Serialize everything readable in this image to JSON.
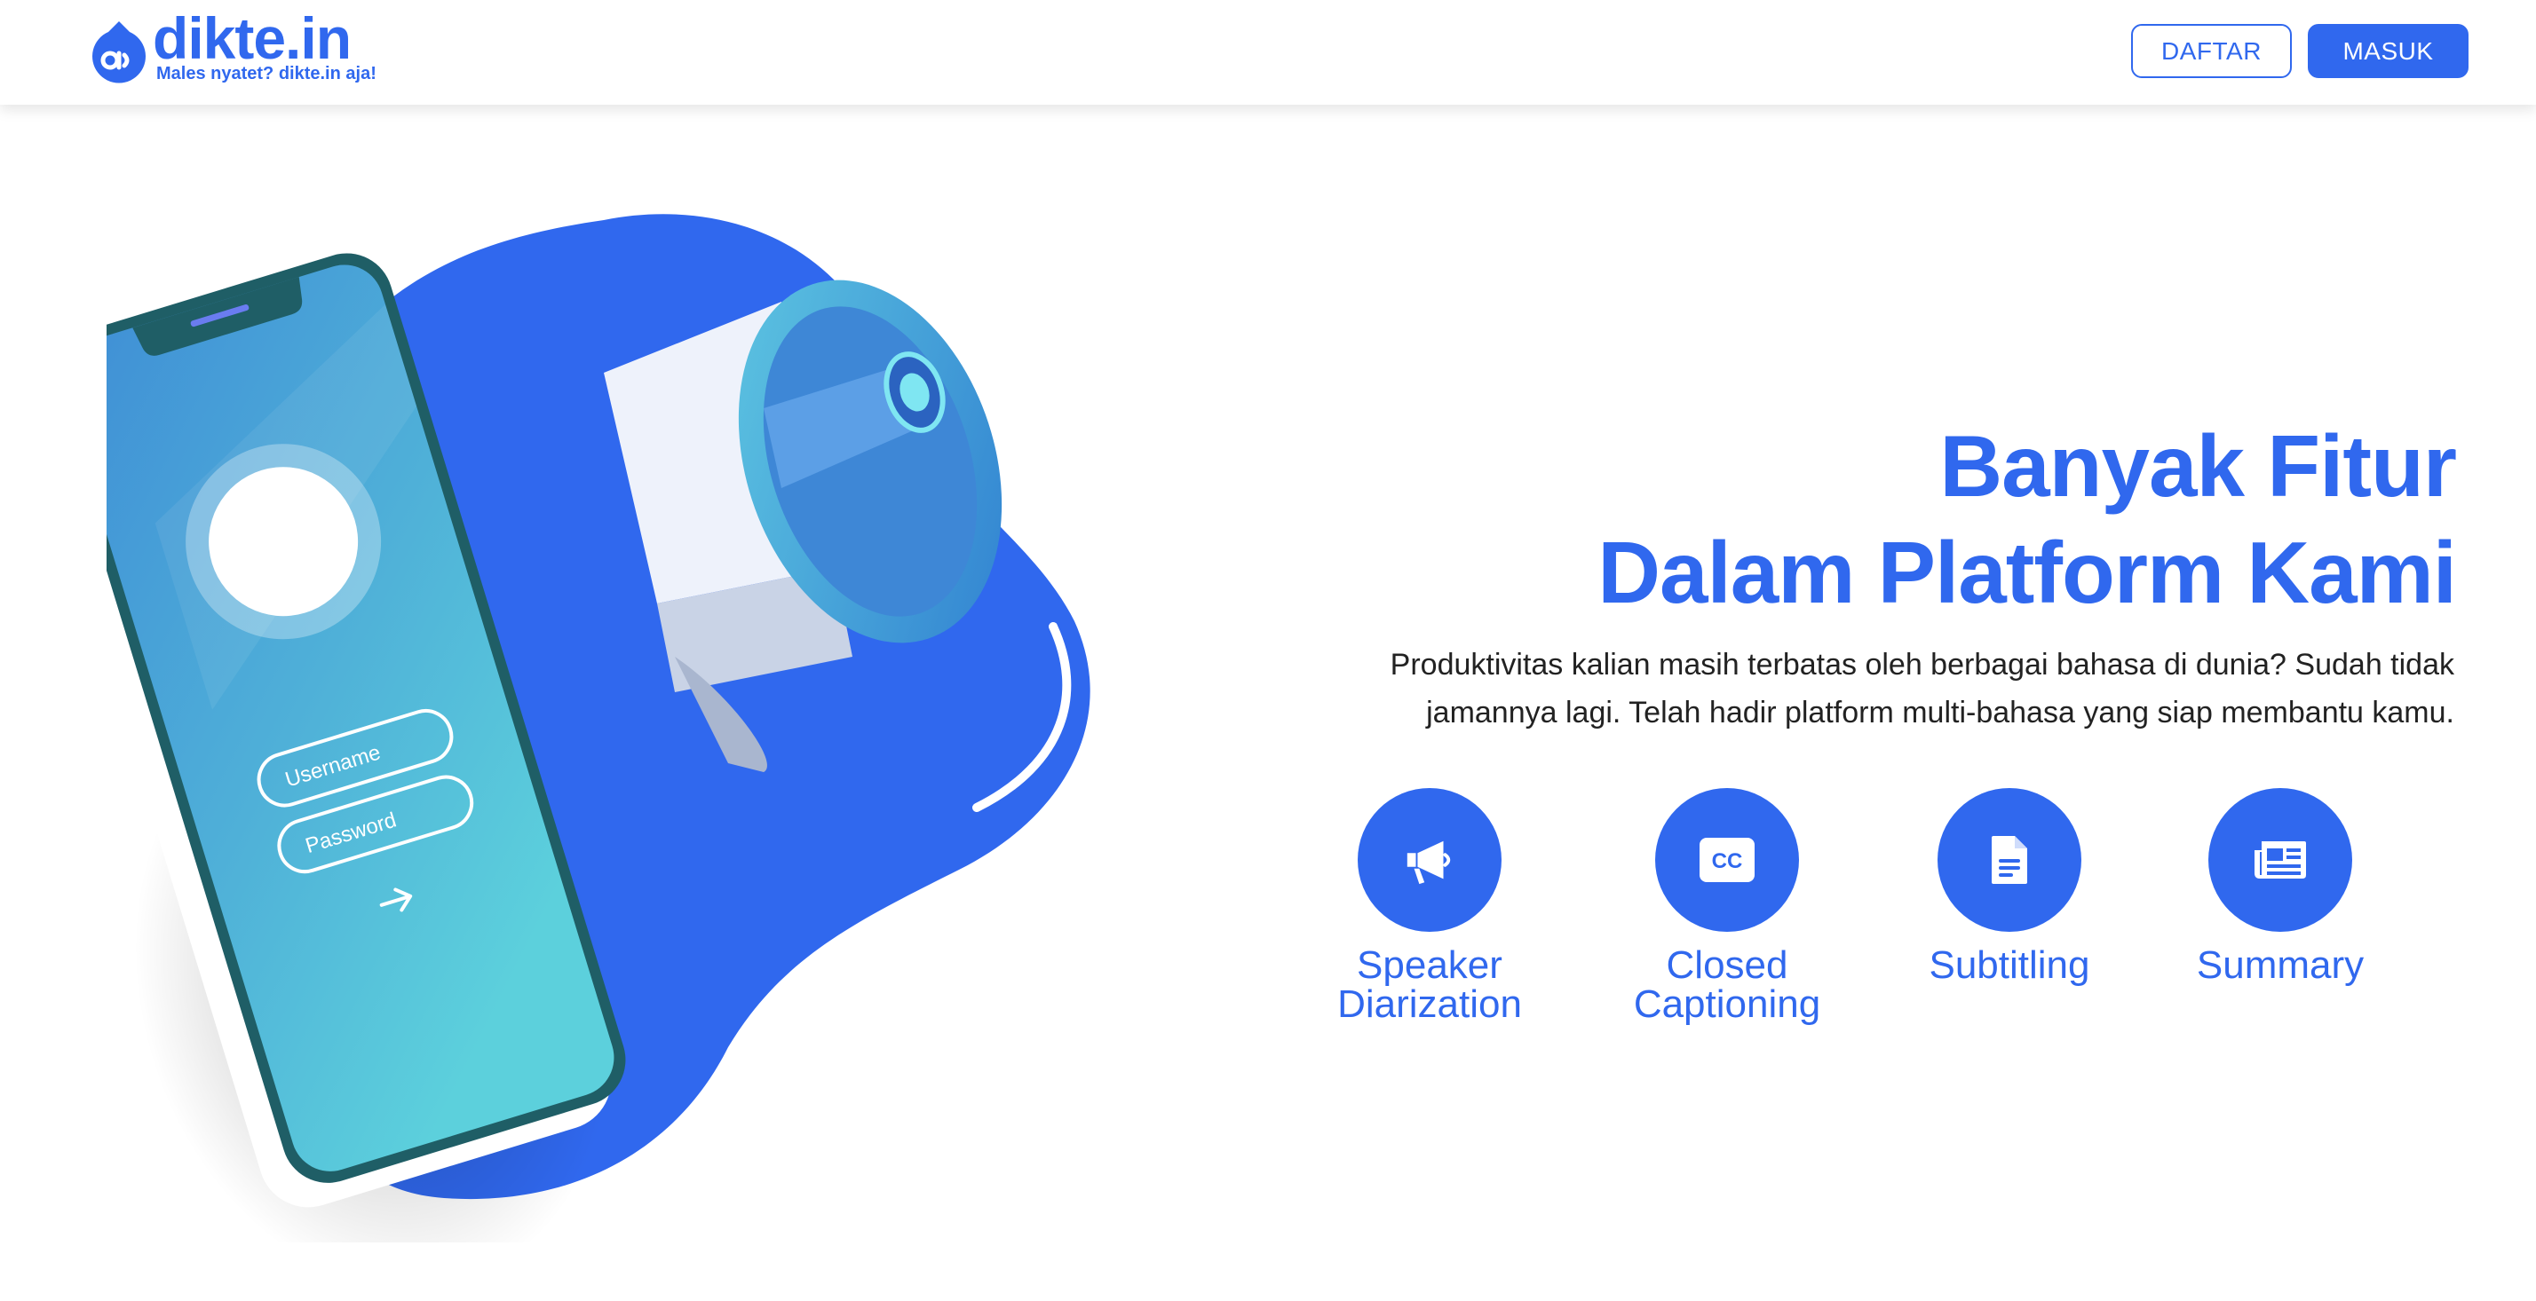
{
  "brand": {
    "name": "dikte.in",
    "tagline": "Males nyatet? dikte.in aja!",
    "color": "#3068ee"
  },
  "nav": {
    "daftar_label": "DAFTAR",
    "masuk_label": "MASUK"
  },
  "illustration": {
    "username_placeholder": "Username",
    "password_placeholder": "Password",
    "submit_icon": "arrow-right-icon"
  },
  "hero": {
    "title_line1": "Banyak Fitur",
    "title_line2": "Dalam Platform Kami",
    "desc_line1": "Produktivitas kalian masih terbatas oleh berbagai bahasa di dunia? Sudah tidak",
    "desc_line2": "jamannya lagi. Telah hadir platform multi-bahasa yang siap membantu kamu."
  },
  "features": [
    {
      "icon": "megaphone-icon",
      "line1": "Speaker",
      "line2": "Diarization"
    },
    {
      "icon": "closed-caption-icon",
      "line1": "Closed",
      "line2": "Captioning"
    },
    {
      "icon": "document-icon",
      "line1": "Subtitling",
      "line2": ""
    },
    {
      "icon": "newspaper-icon",
      "line1": "Summary",
      "line2": ""
    }
  ]
}
